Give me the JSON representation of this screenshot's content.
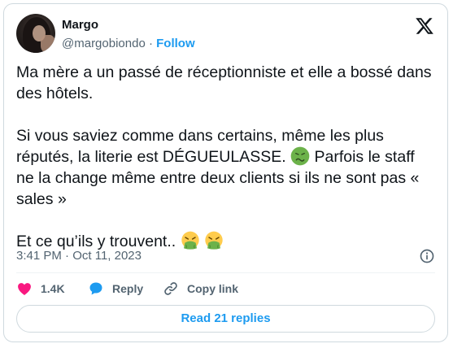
{
  "author": {
    "name": "Margo",
    "handle": "@margobiondo",
    "separator": "·",
    "follow_label": "Follow"
  },
  "tweet": {
    "line1": "Ma mère a un passé de réceptionniste et elle a bossé dans des hôtels.",
    "line2a": "Si vous saviez comme dans certains, même les plus réputés, la literie est DÉGUEULASSE.",
    "line2b": "Parfois le staff ne la change même entre deux clients si ils ne sont pas « sales »",
    "line3": "Et ce qu’ils y trouvent..",
    "emojis": [
      "nauseated-face",
      "vomiting-face",
      "vomiting-face"
    ]
  },
  "meta": {
    "time": "3:41 PM",
    "separator": "·",
    "date": "Oct 11, 2023"
  },
  "actions": {
    "likes": "1.4K",
    "reply_label": "Reply",
    "copy_label": "Copy link"
  },
  "read_replies_label": "Read 21 replies",
  "colors": {
    "accent": "#1d9bf0",
    "like": "#f91880",
    "text": "#0f1419",
    "secondary": "#536471",
    "border": "#cfd9de",
    "emoji_green": "#6cb24a"
  }
}
